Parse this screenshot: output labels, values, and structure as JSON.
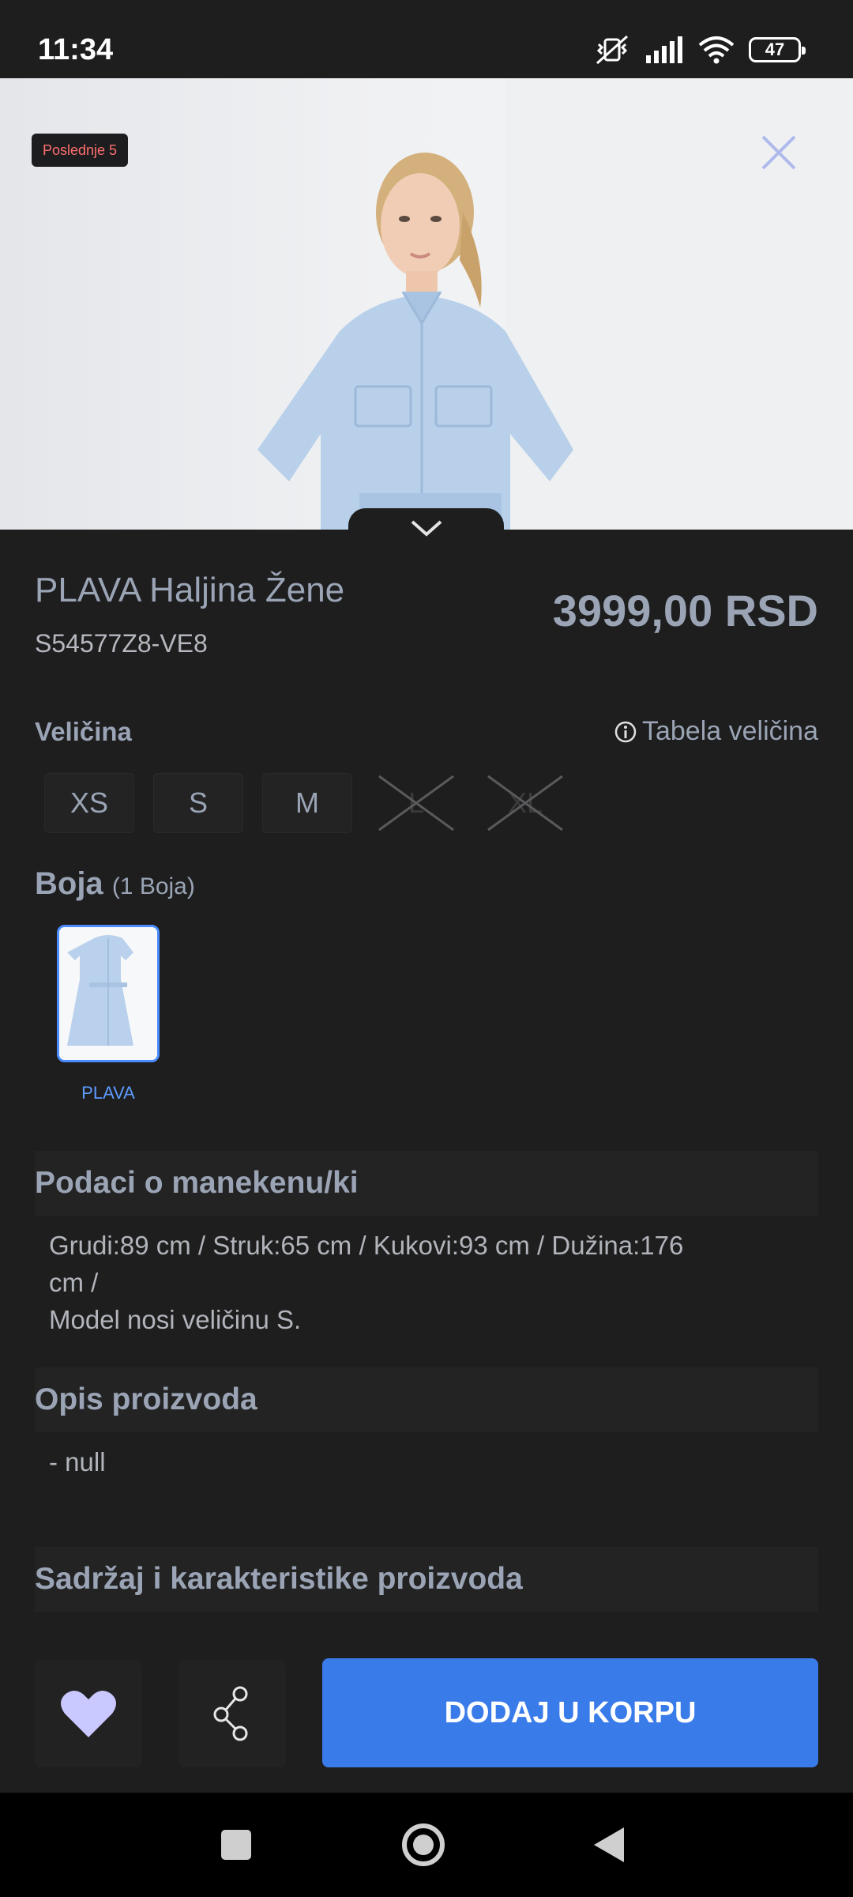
{
  "status": {
    "time": "11:34",
    "battery": "47",
    "icons": [
      "mute-vibrate-icon",
      "cell-signal-icon",
      "wifi-icon",
      "battery-icon"
    ]
  },
  "hero": {
    "badge": "Poslednje 5"
  },
  "product": {
    "title": "PLAVA Haljina Žene",
    "sku": "S54577Z8-VE8",
    "price": "3999,00 RSD"
  },
  "size": {
    "label": "Veličina",
    "table_link": "Tabela veličina",
    "options": [
      {
        "label": "XS",
        "available": true
      },
      {
        "label": "S",
        "available": true
      },
      {
        "label": "M",
        "available": true
      },
      {
        "label": "L",
        "available": false
      },
      {
        "label": "XL",
        "available": false
      }
    ]
  },
  "color": {
    "label": "Boja",
    "count": "(1 Boja)",
    "options": [
      {
        "name": "PLAVA",
        "selected": true
      }
    ]
  },
  "sections": {
    "model": {
      "title": "Podaci o manekenu/ki",
      "body_line1": "Grudi:89 cm / Struk:65 cm / Kukovi:93 cm / Dužina:176",
      "body_line2": "cm /",
      "body_line3": "Model nosi veličinu S."
    },
    "description": {
      "title": "Opis proizvoda",
      "body": "- null"
    },
    "composition": {
      "title": "Sadržaj i karakteristike proizvoda"
    }
  },
  "actions": {
    "add_to_cart": "DODAJ U KORPU"
  },
  "colors": {
    "accent": "#3a7bea",
    "background": "#1e1e1f",
    "text": "#9aa4b5",
    "badge_text": "#ff6e6e"
  }
}
